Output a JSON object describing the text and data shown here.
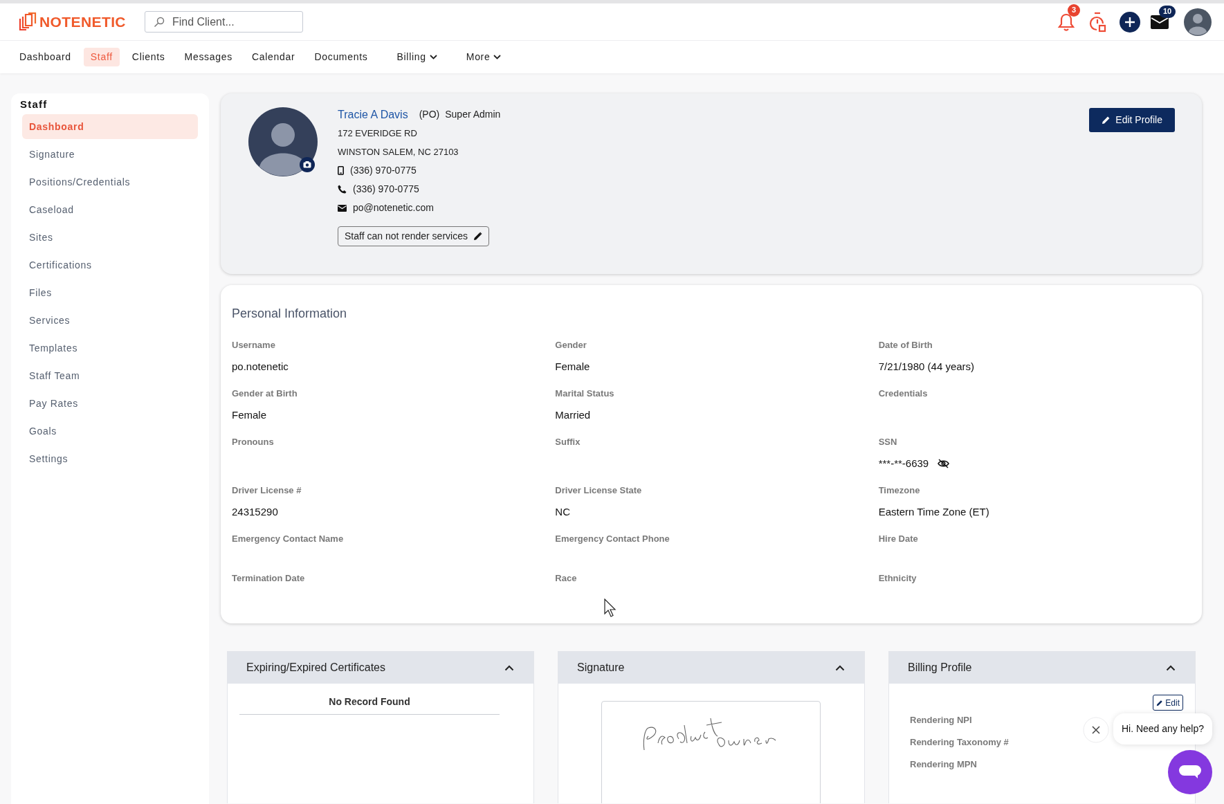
{
  "header": {
    "logo": {
      "text": "NOTENETIC"
    },
    "search": {
      "placeholder": "Find Client..."
    },
    "notifications": {
      "count": "3"
    },
    "messages": {
      "count": "10"
    }
  },
  "nav": [
    {
      "label": "Dashboard",
      "selected": false,
      "dropdown": false
    },
    {
      "label": "Staff",
      "selected": true,
      "dropdown": false
    },
    {
      "label": "Clients",
      "selected": false,
      "dropdown": false
    },
    {
      "label": "Messages",
      "selected": false,
      "dropdown": false
    },
    {
      "label": "Calendar",
      "selected": false,
      "dropdown": false
    },
    {
      "label": "Documents",
      "selected": false,
      "dropdown": false
    },
    {
      "label": "Billing",
      "selected": false,
      "dropdown": true
    },
    {
      "label": "More",
      "selected": false,
      "dropdown": true
    }
  ],
  "sidebar": {
    "title": "Staff",
    "items": [
      {
        "label": "Dashboard",
        "selected": true
      },
      {
        "label": "Signature",
        "selected": false
      },
      {
        "label": "Positions/Credentials",
        "selected": false
      },
      {
        "label": "Caseload",
        "selected": false
      },
      {
        "label": "Sites",
        "selected": false
      },
      {
        "label": "Certifications",
        "selected": false
      },
      {
        "label": "Files",
        "selected": false
      },
      {
        "label": "Services",
        "selected": false
      },
      {
        "label": "Templates",
        "selected": false
      },
      {
        "label": "Staff Team",
        "selected": false
      },
      {
        "label": "Pay Rates",
        "selected": false
      },
      {
        "label": "Goals",
        "selected": false
      },
      {
        "label": "Settings",
        "selected": false
      }
    ]
  },
  "profile": {
    "name": "Tracie A Davis",
    "initials": "(PO)",
    "role": "Super Admin",
    "address_lines": [
      "172 EVERIDGE RD",
      "WINSTON SALEM, NC 27103"
    ],
    "contacts": [
      {
        "kind": "mobile",
        "text": "(336) 970-0775"
      },
      {
        "kind": "phone",
        "text": "(336) 970-0775"
      },
      {
        "kind": "email",
        "text": "po@notenetic.com"
      }
    ],
    "render_status": "Staff can not render services",
    "edit_button": "Edit Profile"
  },
  "personal_information": {
    "title": "Personal Information",
    "fields": [
      {
        "label": "Username",
        "value": "po.notenetic"
      },
      {
        "label": "Gender",
        "value": "Female"
      },
      {
        "label": "Date of Birth",
        "value": "7/21/1980 (44 years)"
      },
      {
        "label": "Gender at Birth",
        "value": "Female"
      },
      {
        "label": "Marital Status",
        "value": "Married"
      },
      {
        "label": "Credentials"
      },
      {
        "label": "Pronouns"
      },
      {
        "label": "Suffix"
      },
      {
        "label": "SSN",
        "value": "***-**-6639",
        "masked": true
      },
      {
        "label": "Driver License #",
        "value": "24315290"
      },
      {
        "label": "Driver License State",
        "value": "NC"
      },
      {
        "label": "Timezone",
        "value": "Eastern Time Zone (ET)"
      },
      {
        "label": "Emergency Contact Name"
      },
      {
        "label": "Emergency Contact Phone"
      },
      {
        "label": "Hire Date"
      },
      {
        "label": "Termination Date"
      },
      {
        "label": "Race"
      },
      {
        "label": "Ethnicity"
      }
    ]
  },
  "panels": [
    {
      "kind": "list",
      "title": "Expiring/Expired Certificates",
      "expanded": true,
      "empty_text": "No Record Found"
    },
    {
      "kind": "signature",
      "title": "Signature",
      "expanded": true
    },
    {
      "kind": "fields",
      "title": "Billing Profile",
      "expanded": true,
      "edit_button": "Edit",
      "fields": [
        "Rendering NPI",
        "Rendering Taxonomy #",
        "Rendering MPN"
      ]
    }
  ],
  "chat_widget": {
    "message": "Hi. Need any help?"
  }
}
